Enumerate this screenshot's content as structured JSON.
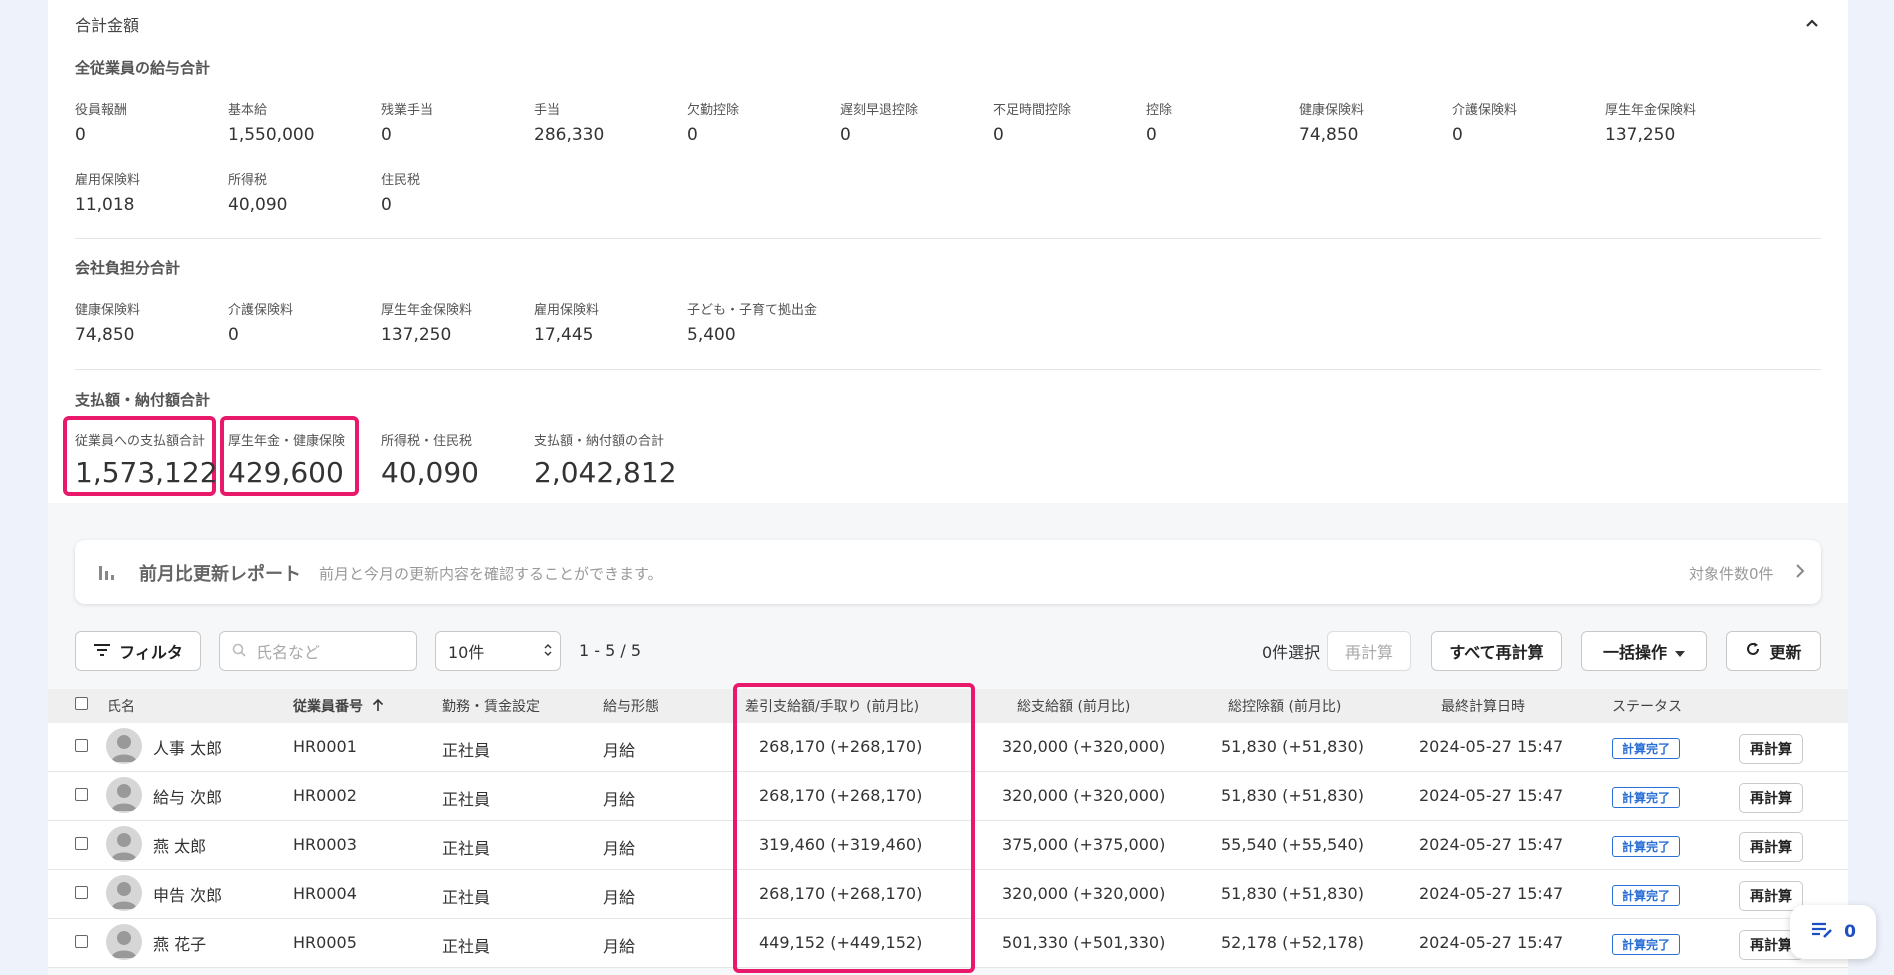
{
  "header": {
    "title": "合計金額"
  },
  "employee_totals": {
    "title": "全従業員の給与合計",
    "row1": [
      {
        "label": "役員報酬",
        "value": "0"
      },
      {
        "label": "基本給",
        "value": "1,550,000"
      },
      {
        "label": "残業手当",
        "value": "0"
      },
      {
        "label": "手当",
        "value": "286,330"
      },
      {
        "label": "欠勤控除",
        "value": "0"
      },
      {
        "label": "遅刻早退控除",
        "value": "0"
      },
      {
        "label": "不足時間控除",
        "value": "0"
      },
      {
        "label": "控除",
        "value": "0"
      },
      {
        "label": "健康保険料",
        "value": "74,850"
      },
      {
        "label": "介護保険料",
        "value": "0"
      },
      {
        "label": "厚生年金保険料",
        "value": "137,250"
      }
    ],
    "row2": [
      {
        "label": "雇用保険料",
        "value": "11,018"
      },
      {
        "label": "所得税",
        "value": "40,090"
      },
      {
        "label": "住民税",
        "value": "0"
      }
    ]
  },
  "company_totals": {
    "title": "会社負担分合計",
    "items": [
      {
        "label": "健康保険料",
        "value": "74,850"
      },
      {
        "label": "介護保険料",
        "value": "0"
      },
      {
        "label": "厚生年金保険料",
        "value": "137,250"
      },
      {
        "label": "雇用保険料",
        "value": "17,445"
      },
      {
        "label": "子ども・子育て拠出金",
        "value": "5,400"
      }
    ]
  },
  "payment_totals": {
    "title": "支払額・納付額合計",
    "items": [
      {
        "label": "従業員への支払額合計",
        "value": "1,573,122"
      },
      {
        "label": "厚生年金・健康保険",
        "value": "429,600"
      },
      {
        "label": "所得税・住民税",
        "value": "40,090"
      },
      {
        "label": "支払額・納付額の合計",
        "value": "2,042,812"
      }
    ]
  },
  "report": {
    "title": "前月比更新レポート",
    "description": "前月と今月の更新内容を確認することができます。",
    "count": "対象件数0件"
  },
  "toolbar": {
    "filter_label": "フィルタ",
    "search_placeholder": "氏名など",
    "page_size": "10件",
    "range": "1 - 5 / 5",
    "selected_count": "0件選択",
    "recalc_label": "再計算",
    "recalc_all_label": "すべて再計算",
    "bulk_label": "一括操作",
    "refresh_label": "更新"
  },
  "table": {
    "headers": [
      "氏名",
      "従業員番号",
      "勤務・賃金設定",
      "給与形態",
      "差引支給額/手取り (前月比)",
      "総支給額 (前月比)",
      "総控除額 (前月比)",
      "最終計算日時",
      "ステータス"
    ],
    "rows": [
      {
        "name": "人事 太郎",
        "id": "HR0001",
        "setting": "正社員",
        "type": "月給",
        "net": "268,170 (+268,170)",
        "gross": "320,000 (+320,000)",
        "deduction": "51,830 (+51,830)",
        "calculated": "2024-05-27 15:47",
        "status": "計算完了",
        "action": "再計算"
      },
      {
        "name": "給与 次郎",
        "id": "HR0002",
        "setting": "正社員",
        "type": "月給",
        "net": "268,170 (+268,170)",
        "gross": "320,000 (+320,000)",
        "deduction": "51,830 (+51,830)",
        "calculated": "2024-05-27 15:47",
        "status": "計算完了",
        "action": "再計算"
      },
      {
        "name": "燕 太郎",
        "id": "HR0003",
        "setting": "正社員",
        "type": "月給",
        "net": "319,460 (+319,460)",
        "gross": "375,000 (+375,000)",
        "deduction": "55,540 (+55,540)",
        "calculated": "2024-05-27 15:47",
        "status": "計算完了",
        "action": "再計算"
      },
      {
        "name": "申告 次郎",
        "id": "HR0004",
        "setting": "正社員",
        "type": "月給",
        "net": "268,170 (+268,170)",
        "gross": "320,000 (+320,000)",
        "deduction": "51,830 (+51,830)",
        "calculated": "2024-05-27 15:47",
        "status": "計算完了",
        "action": "再計算"
      },
      {
        "name": "燕 花子",
        "id": "HR0005",
        "setting": "正社員",
        "type": "月給",
        "net": "449,152 (+449,152)",
        "gross": "501,330 (+501,330)",
        "deduction": "52,178 (+52,178)",
        "calculated": "2024-05-27 15:47",
        "status": "計算完了",
        "action": "再計算"
      }
    ]
  },
  "fab": {
    "count": "0"
  },
  "colors": {
    "highlight": "#e8196a",
    "accent": "#2a6fd6",
    "page_bg": "#eef2fa"
  }
}
